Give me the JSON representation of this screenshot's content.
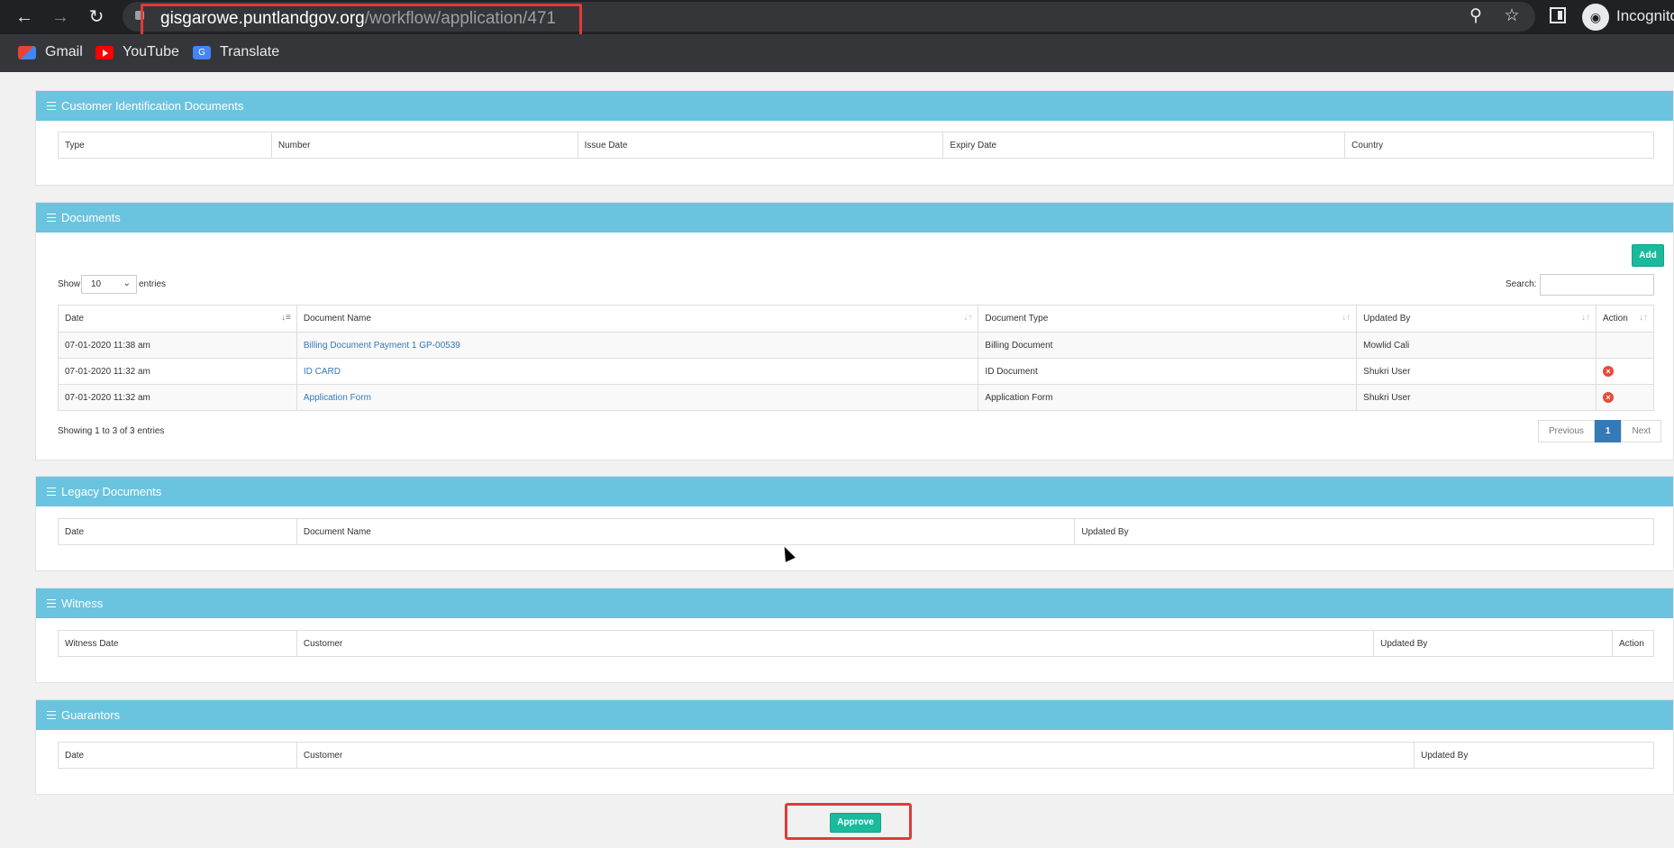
{
  "browser": {
    "url_host": "gisgarowe.puntlandgov.org",
    "url_path": "/workflow/application/471",
    "profile_label": "Incognito",
    "bookmarks": [
      {
        "label": "Gmail",
        "icon": "gmail-icon"
      },
      {
        "label": "YouTube",
        "icon": "youtube-icon"
      },
      {
        "label": "Translate",
        "icon": "translate-icon"
      }
    ]
  },
  "identification": {
    "title": "Customer Identification Documents",
    "columns": [
      "Type",
      "Number",
      "Issue Date",
      "Expiry Date",
      "Country"
    ]
  },
  "documents": {
    "title": "Documents",
    "add_label": "Add",
    "show_label": "Show",
    "entries_label": "entries",
    "page_size": "10",
    "search_label": "Search:",
    "columns": [
      "Date",
      "Document Name",
      "Document Type",
      "Updated By",
      "Action"
    ],
    "rows": [
      {
        "date": "07-01-2020 11:38 am",
        "name": "Billing Document Payment 1 GP-00539",
        "type": "Billing Document",
        "updated_by": "Mowlid Cali"
      },
      {
        "date": "07-01-2020 11:32 am",
        "name": "ID CARD",
        "type": "ID Document",
        "updated_by": "Shukri User"
      },
      {
        "date": "07-01-2020 11:32 am",
        "name": "Application Form",
        "type": "Application Form",
        "updated_by": "Shukri User"
      }
    ],
    "info": "Showing 1 to 3 of 3 entries",
    "pager": {
      "previous": "Previous",
      "current": "1",
      "next": "Next"
    }
  },
  "legacy": {
    "title": "Legacy Documents",
    "columns": [
      "Date",
      "Document Name",
      "Updated By"
    ]
  },
  "witness": {
    "title": "Witness",
    "columns": [
      "Witness Date",
      "Customer",
      "Updated By",
      "Action"
    ]
  },
  "guarantors": {
    "title": "Guarantors",
    "columns": [
      "Date",
      "Customer",
      "Updated By"
    ]
  },
  "approve_label": "Approve",
  "colors": {
    "panel_header": "#6ac4df",
    "accent_green": "#1abb9c",
    "link": "#337ab7",
    "highlight_red": "#e03a3a"
  }
}
